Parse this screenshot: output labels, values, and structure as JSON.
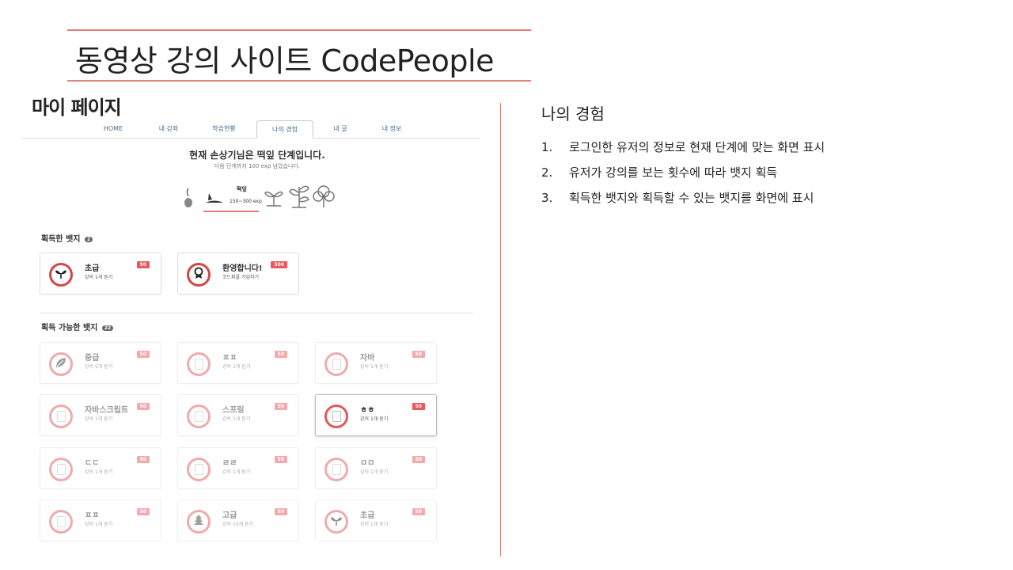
{
  "slide": {
    "title": "동영상 강의 사이트 CodePeople",
    "accent_color": "#e57f77"
  },
  "mypage": {
    "heading": "마이 페이지",
    "tabs": [
      {
        "label": "HOME"
      },
      {
        "label": "내 강좌"
      },
      {
        "label": "학습현황"
      },
      {
        "label": "나의 경험",
        "active": true
      },
      {
        "label": "내 글"
      },
      {
        "label": "내 정보"
      }
    ],
    "level_text": "현재 손상기님은 떡잎 단계입니다.",
    "level_sub": "다음 단계까지 100 exp 남았습니다.",
    "stage": {
      "label": "떡잎",
      "range": "150~300 exp"
    },
    "earned": {
      "title": "획득한 뱃지",
      "count": "2",
      "badges": [
        {
          "name": "초급",
          "desc": "강의 1개 듣기",
          "points": "50",
          "icon": "sprout-icon"
        },
        {
          "name": "환영합니다!",
          "desc": "코드피플 가입하기",
          "points": "500",
          "icon": "medal-icon"
        }
      ]
    },
    "available": {
      "title": "획득 가능한 뱃지",
      "count": "22",
      "badges": [
        {
          "name": "중급",
          "desc": "강의 5개 듣기",
          "points": "50",
          "icon": "leaf-icon",
          "highlight": false
        },
        {
          "name": "ㅍㅍ",
          "desc": "강의 1개 듣기",
          "points": "50",
          "icon": "placeholder-icon",
          "highlight": false
        },
        {
          "name": "자바",
          "desc": "강의 1개 듣기",
          "points": "50",
          "icon": "placeholder-icon",
          "highlight": false
        },
        {
          "name": "자바스크립트",
          "desc": "강의 1개 듣기",
          "points": "50",
          "icon": "placeholder-icon",
          "highlight": false
        },
        {
          "name": "스프링",
          "desc": "강의 1개 듣기",
          "points": "50",
          "icon": "placeholder-icon",
          "highlight": false
        },
        {
          "name": "ㅎㅎ",
          "desc": "강의 1개 듣기",
          "points": "50",
          "icon": "placeholder-icon",
          "highlight": true
        },
        {
          "name": "ㄷㄷ",
          "desc": "강의 1개 듣기",
          "points": "50",
          "icon": "placeholder-icon",
          "highlight": false
        },
        {
          "name": "ㄹㄹ",
          "desc": "강의 1개 듣기",
          "points": "50",
          "icon": "placeholder-icon",
          "highlight": false
        },
        {
          "name": "ㅁㅁ",
          "desc": "강의 1개 듣기",
          "points": "50",
          "icon": "placeholder-icon",
          "highlight": false
        },
        {
          "name": "ㅍㅍ",
          "desc": "강의 1개 듣기",
          "points": "50",
          "icon": "placeholder-icon",
          "highlight": false
        },
        {
          "name": "고급",
          "desc": "강의 15개 듣기",
          "points": "50",
          "icon": "tree-icon",
          "highlight": false
        },
        {
          "name": "초급",
          "desc": "강의 1개 듣기",
          "points": "50",
          "icon": "sprout-icon",
          "highlight": false
        }
      ]
    }
  },
  "experience": {
    "title": "나의 경험",
    "items": [
      {
        "num": "1.",
        "text": "로그인한 유저의 정보로 현재 단계에 맞는 화면 표시"
      },
      {
        "num": "2.",
        "text": "유저가 강의를 보는 횟수에 따라 뱃지 획득"
      },
      {
        "num": "3.",
        "text": "획득한 뱃지와 획득할 수 있는 뱃지를 화면에 표시"
      }
    ]
  }
}
